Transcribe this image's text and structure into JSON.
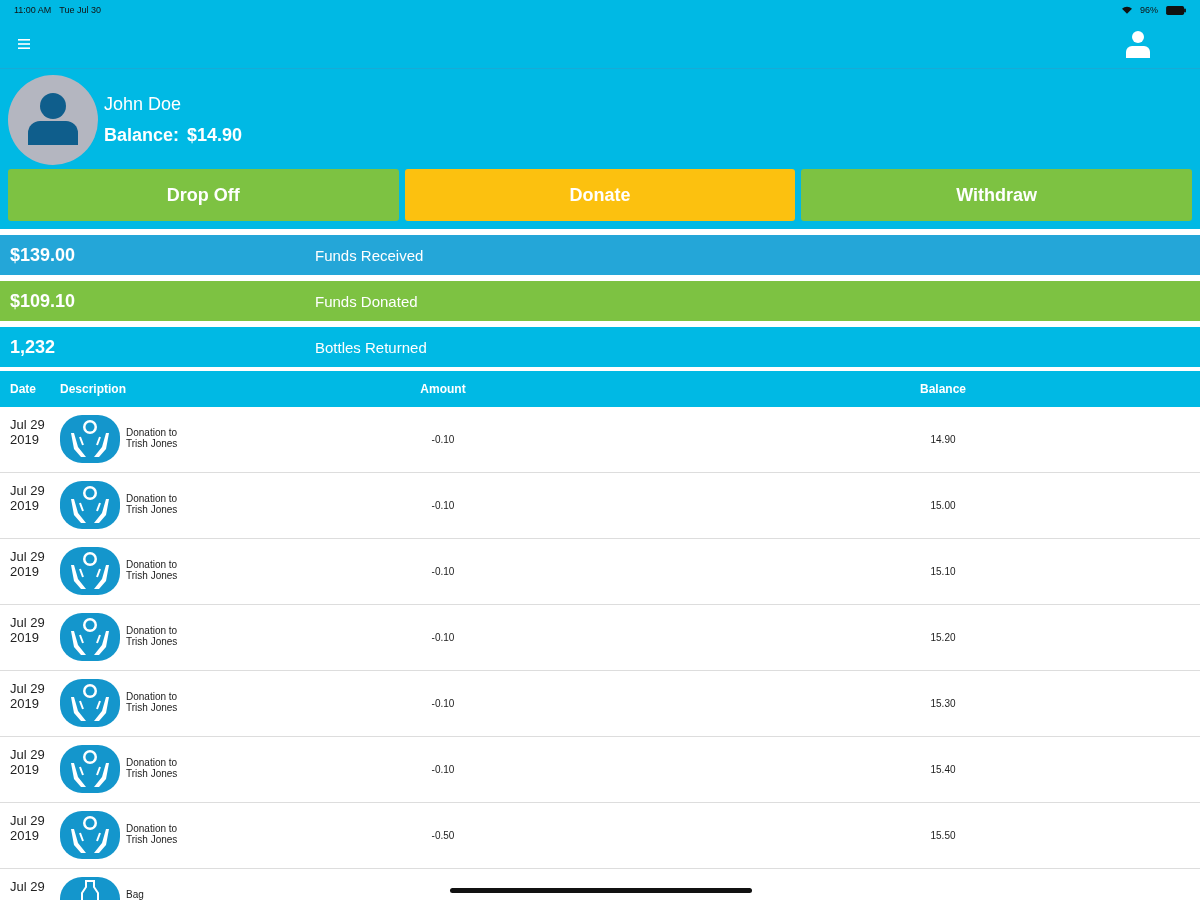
{
  "status_bar": {
    "time": "11:00 AM",
    "date": "Tue Jul 30",
    "battery": "96%"
  },
  "profile": {
    "name": "John Doe",
    "balance_label": "Balance:",
    "balance": "$14.90"
  },
  "actions": [
    {
      "label": "Drop Off",
      "color": "#7dc242"
    },
    {
      "label": "Donate",
      "color": "#fcc10f"
    },
    {
      "label": "Withdraw",
      "color": "#7dc242"
    }
  ],
  "stats": [
    {
      "value": "$139.00",
      "label": "Funds Received",
      "color": "#24a6d8"
    },
    {
      "value": "$109.10",
      "label": "Funds Donated",
      "color": "#7dc242"
    },
    {
      "value": "1,232",
      "label": "Bottles Returned",
      "color": "#00b9e4"
    }
  ],
  "table": {
    "columns": [
      "Date",
      "Description",
      "Amount",
      "Balance"
    ],
    "rows": [
      {
        "kind": "donation",
        "date": "Jul 29 2019",
        "description": "Donation to Trish Jones",
        "amount": "-0.10",
        "balance": "14.90"
      },
      {
        "kind": "donation",
        "date": "Jul 29 2019",
        "description": "Donation to Trish Jones",
        "amount": "-0.10",
        "balance": "15.00"
      },
      {
        "kind": "donation",
        "date": "Jul 29 2019",
        "description": "Donation to Trish Jones",
        "amount": "-0.10",
        "balance": "15.10"
      },
      {
        "kind": "donation",
        "date": "Jul 29 2019",
        "description": "Donation to Trish Jones",
        "amount": "-0.10",
        "balance": "15.20"
      },
      {
        "kind": "donation",
        "date": "Jul 29 2019",
        "description": "Donation to Trish Jones",
        "amount": "-0.10",
        "balance": "15.30"
      },
      {
        "kind": "donation",
        "date": "Jul 29 2019",
        "description": "Donation to Trish Jones",
        "amount": "-0.10",
        "balance": "15.40"
      },
      {
        "kind": "donation",
        "date": "Jul 29 2019",
        "description": "Donation to Trish Jones",
        "amount": "-0.50",
        "balance": "15.50"
      },
      {
        "kind": "bottle",
        "date": "Jul 29",
        "description": "Bag"
      }
    ]
  }
}
